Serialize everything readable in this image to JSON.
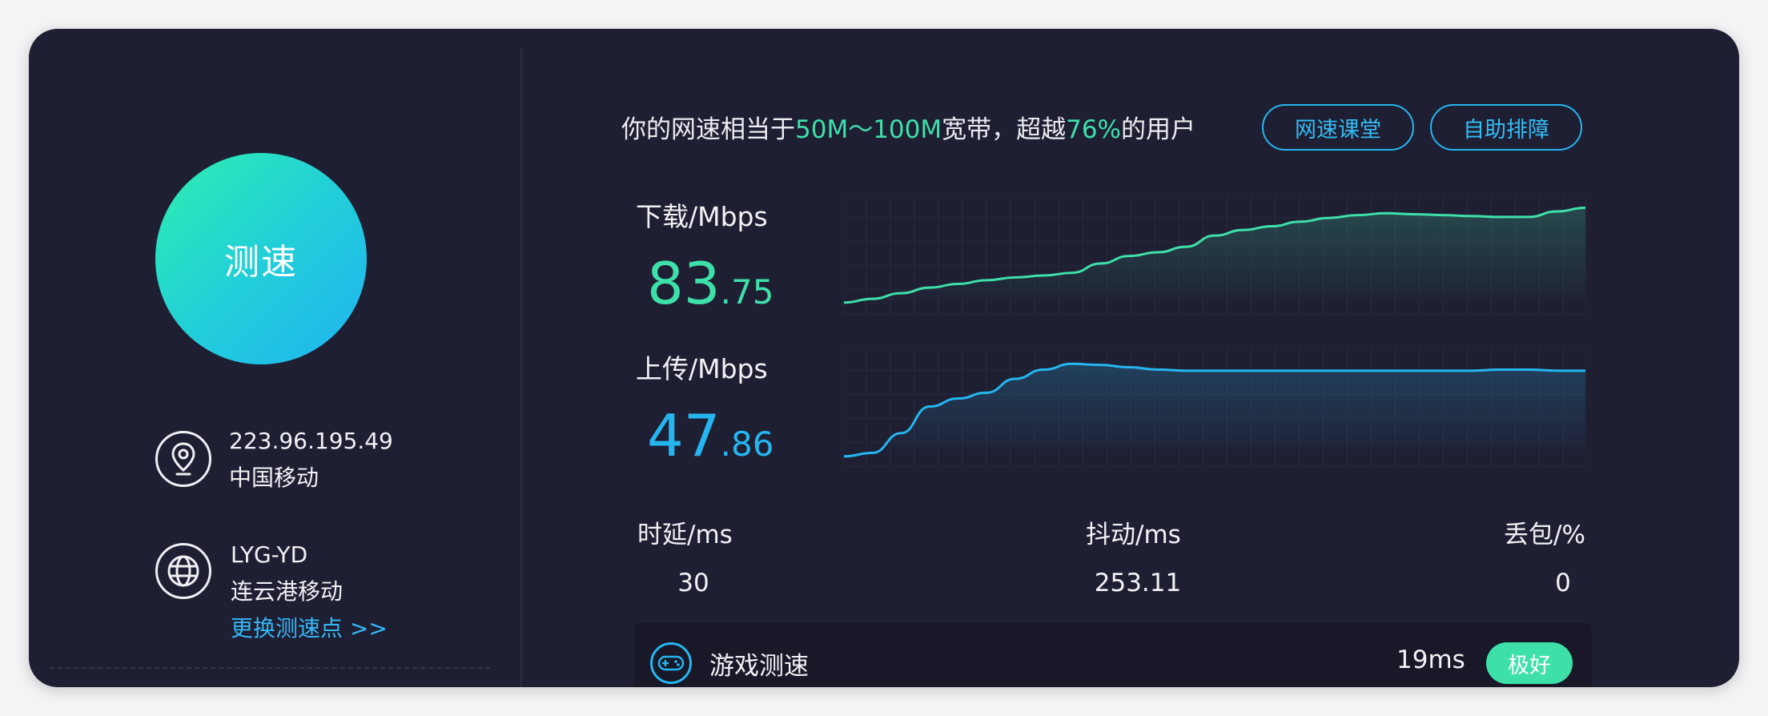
{
  "action": {
    "label": "测速"
  },
  "client": {
    "ip": "223.96.195.49",
    "isp": "中国移动"
  },
  "server": {
    "code": "LYG-YD",
    "name": "连云港移动",
    "change_link": "更换测速点 >>"
  },
  "summary": {
    "prefix": "你的网速相当于",
    "bandwidth": "50M～100M",
    "middle": "宽带，超越",
    "percent": "76%",
    "suffix": "的用户"
  },
  "buttons": {
    "speed_class": "网速课堂",
    "self_help": "自助排障"
  },
  "download": {
    "label": "下载/Mbps",
    "int": "83",
    "dec": ".75",
    "color": "#3ee0a9",
    "trend": [
      8,
      12,
      18,
      24,
      28,
      32,
      35,
      37,
      40,
      50,
      58,
      62,
      68,
      80,
      86,
      90,
      95,
      99,
      102,
      104,
      103,
      102,
      101,
      100,
      100,
      106,
      110
    ]
  },
  "upload": {
    "label": "上传/Mbps",
    "int": "47",
    "dec": ".86",
    "color": "#25b6f0",
    "trend": [
      5,
      8,
      25,
      48,
      55,
      60,
      72,
      80,
      85,
      84,
      82,
      80,
      79,
      79,
      79,
      79,
      79,
      79,
      79,
      79,
      79,
      79,
      79,
      80,
      80,
      79,
      79
    ]
  },
  "stats": {
    "latency": {
      "label": "时延/ms",
      "value": "30"
    },
    "jitter": {
      "label": "抖动/ms",
      "value": "253.11"
    },
    "loss": {
      "label": "丢包/%",
      "value": "0"
    }
  },
  "game": {
    "label": "游戏测速",
    "latency": "19ms",
    "rating": "极好"
  }
}
